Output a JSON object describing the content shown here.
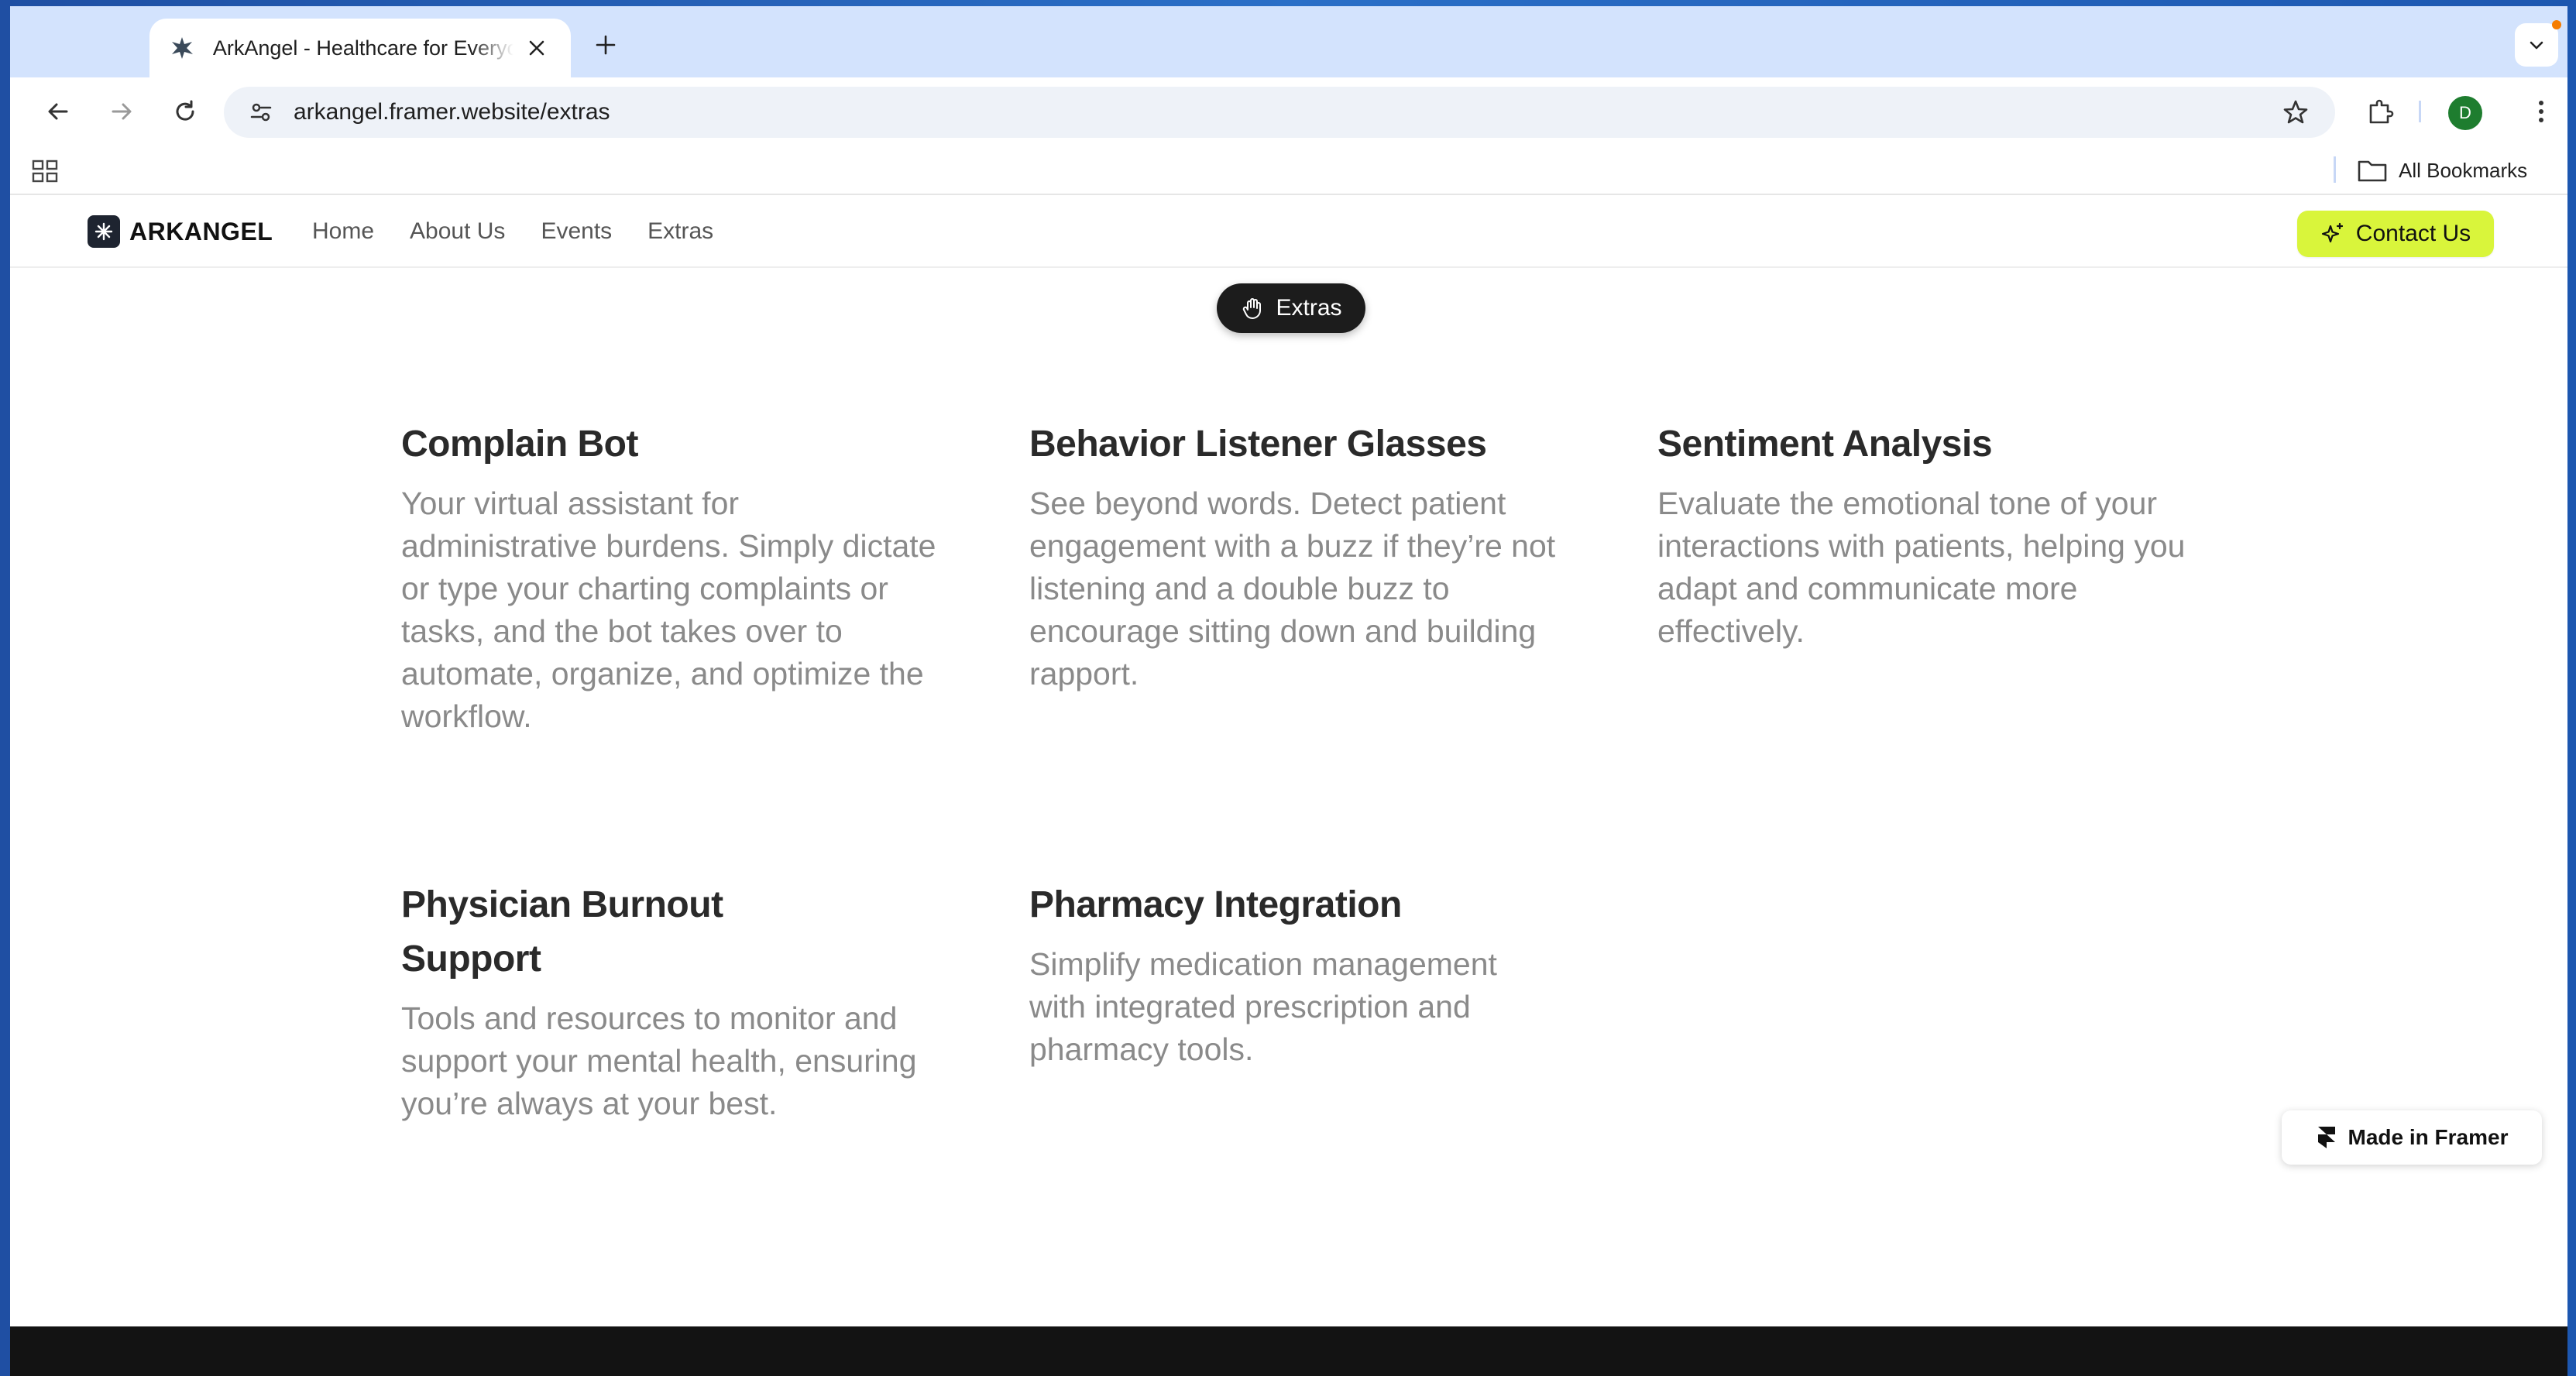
{
  "browser": {
    "tab_title": "ArkAngel - Healthcare for Everyone",
    "url": "arkangel.framer.website/extras",
    "profile_initial": "D",
    "all_bookmarks_label": "All Bookmarks"
  },
  "site": {
    "logo_text": "ARKANGEL",
    "nav": [
      "Home",
      "About Us",
      "Events",
      "Extras"
    ],
    "contact_label": "Contact Us",
    "section_pill": "Extras",
    "accent_color": "#d9f53b"
  },
  "features": [
    {
      "title": "Complain Bot",
      "description": "Your virtual assistant for administrative burdens. Simply dictate or type your charting complaints or tasks, and the bot takes over to automate, organize, and optimize the workflow."
    },
    {
      "title": "Behavior Listener Glasses",
      "description": "See beyond words. Detect patient engagement with a buzz if they’re not listening and a double buzz to encourage sitting down and building rapport."
    },
    {
      "title": "Sentiment Analysis",
      "description": "Evaluate the emotional tone of your interactions with patients, helping you adapt and communicate more effectively."
    },
    {
      "title": "Physician Burnout Support",
      "description": "Tools and resources to monitor and support your mental health, ensuring you’re always at your best."
    },
    {
      "title": "Pharmacy Integration",
      "description": "Simplify medication management with integrated prescription and pharmacy tools."
    }
  ],
  "badge": {
    "label": "Made in Framer"
  }
}
